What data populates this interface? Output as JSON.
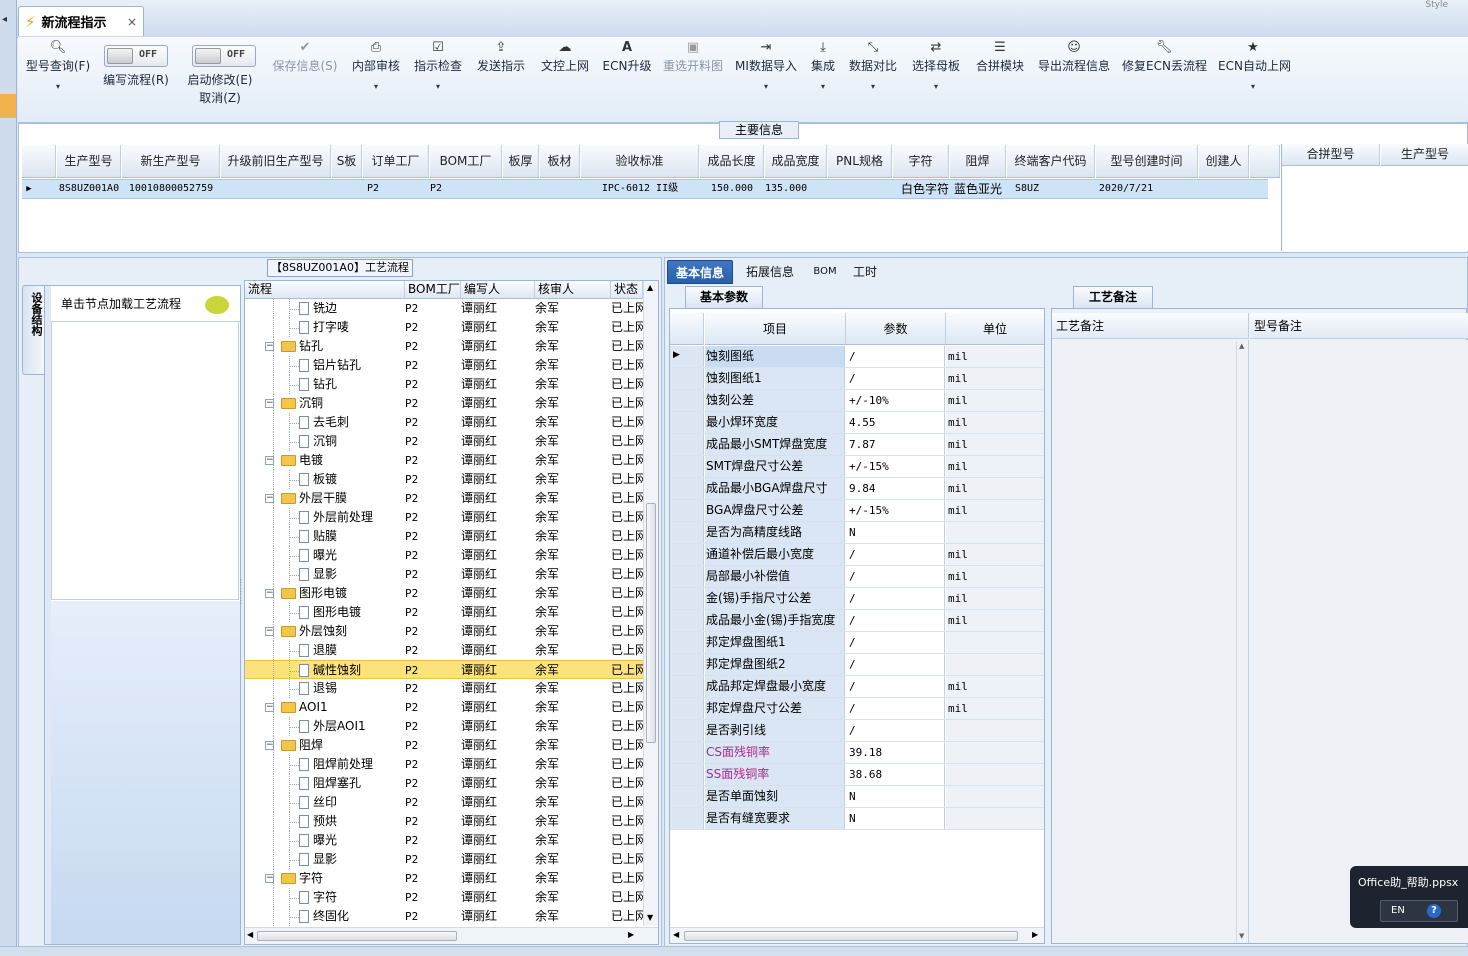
{
  "window": {
    "tab_title": "新流程指示",
    "close_glyph": "×",
    "top_right_hint": "Style"
  },
  "toolbar": {
    "query_model": "型号查询(F)",
    "edit_flow": "编写流程(R)",
    "edit_flow_toggle": "OFF",
    "enable_modify": "启动修改(E)",
    "enable_modify_toggle": "OFF",
    "cancel": "取消(Z)",
    "save_info": "保存信息(S)",
    "internal_review": "内部审核",
    "indicator_check": "指示检查",
    "send_indicator": "发送指示",
    "doc_upload": "文控上网",
    "ecn_upgrade": "ECN升级",
    "reselect_cut_chart": "重选开料图",
    "mi_import": "MI数据导入",
    "integrate": "集成",
    "data_compare": "数据对比",
    "select_mother_board": "选择母板",
    "merge_module": "合拼模块",
    "export_flow": "导出流程信息",
    "repair_ecn": "修复ECN丢流程",
    "ecn_auto_upload": "ECN自动上网"
  },
  "main_info": {
    "section_label": "主要信息",
    "columns": [
      "生产型号",
      "新生产型号",
      "升级前旧生产型号",
      "S板",
      "订单工厂",
      "BOM工厂",
      "板厚",
      "板材",
      "验收标准",
      "成品长度",
      "成品宽度",
      "PNL规格",
      "字符",
      "阻焊",
      "终端客户代码",
      "型号创建时间",
      "创建人"
    ],
    "row": {
      "production_model": "8S8UZ001A0",
      "new_production_model": "10010800052759",
      "order_factory": "P2",
      "bom_factory": "P2",
      "acceptance_standard": "IPC-6012 II级",
      "length": "150.000",
      "width": "135.000",
      "character": "白色字符",
      "solder_mask": "蓝色亚光",
      "customer_code": "S8UZ",
      "created_time": "2020/7/21"
    },
    "merge_columns": [
      "合拼型号",
      "生产型号"
    ]
  },
  "left_panel": {
    "flow_title": "【8S8UZ001A0】工艺流程",
    "vertical_tab": "设备结构",
    "device_header": "单击节点加载工艺流程",
    "tree_columns": [
      "流程",
      "BOM工厂",
      "编写人",
      "核审人",
      "状态"
    ],
    "tree_rows": [
      {
        "name": "铣边",
        "level": 1,
        "type": "doc",
        "bom": "P2",
        "writer": "谭丽红",
        "reviewer": "余军",
        "status": "已上网"
      },
      {
        "name": "打字唛",
        "level": 1,
        "type": "doc",
        "bom": "P2",
        "writer": "谭丽红",
        "reviewer": "余军",
        "status": "已上网"
      },
      {
        "name": "钻孔",
        "level": 0,
        "type": "folder",
        "bom": "P2",
        "writer": "谭丽红",
        "reviewer": "余军",
        "status": "已上网"
      },
      {
        "name": "铝片钻孔",
        "level": 1,
        "type": "doc",
        "bom": "P2",
        "writer": "谭丽红",
        "reviewer": "余军",
        "status": "已上网"
      },
      {
        "name": "钻孔",
        "level": 1,
        "type": "doc",
        "bom": "P2",
        "writer": "谭丽红",
        "reviewer": "余军",
        "status": "已上网"
      },
      {
        "name": "沉铜",
        "level": 0,
        "type": "folder",
        "bom": "P2",
        "writer": "谭丽红",
        "reviewer": "余军",
        "status": "已上网"
      },
      {
        "name": "去毛刺",
        "level": 1,
        "type": "doc",
        "bom": "P2",
        "writer": "谭丽红",
        "reviewer": "余军",
        "status": "已上网"
      },
      {
        "name": "沉铜",
        "level": 1,
        "type": "doc",
        "bom": "P2",
        "writer": "谭丽红",
        "reviewer": "余军",
        "status": "已上网"
      },
      {
        "name": "电镀",
        "level": 0,
        "type": "folder",
        "bom": "P2",
        "writer": "谭丽红",
        "reviewer": "余军",
        "status": "已上网"
      },
      {
        "name": "板镀",
        "level": 1,
        "type": "doc",
        "bom": "P2",
        "writer": "谭丽红",
        "reviewer": "余军",
        "status": "已上网"
      },
      {
        "name": "外层干膜",
        "level": 0,
        "type": "folder",
        "bom": "P2",
        "writer": "谭丽红",
        "reviewer": "余军",
        "status": "已上网"
      },
      {
        "name": "外层前处理",
        "level": 1,
        "type": "doc",
        "bom": "P2",
        "writer": "谭丽红",
        "reviewer": "余军",
        "status": "已上网"
      },
      {
        "name": "贴膜",
        "level": 1,
        "type": "doc",
        "bom": "P2",
        "writer": "谭丽红",
        "reviewer": "余军",
        "status": "已上网"
      },
      {
        "name": "曝光",
        "level": 1,
        "type": "doc",
        "bom": "P2",
        "writer": "谭丽红",
        "reviewer": "余军",
        "status": "已上网"
      },
      {
        "name": "显影",
        "level": 1,
        "type": "doc",
        "bom": "P2",
        "writer": "谭丽红",
        "reviewer": "余军",
        "status": "已上网"
      },
      {
        "name": "图形电镀",
        "level": 0,
        "type": "folder",
        "bom": "P2",
        "writer": "谭丽红",
        "reviewer": "余军",
        "status": "已上网"
      },
      {
        "name": "图形电镀",
        "level": 1,
        "type": "doc",
        "bom": "P2",
        "writer": "谭丽红",
        "reviewer": "余军",
        "status": "已上网"
      },
      {
        "name": "外层蚀刻",
        "level": 0,
        "type": "folder",
        "bom": "P2",
        "writer": "谭丽红",
        "reviewer": "余军",
        "status": "已上网"
      },
      {
        "name": "退膜",
        "level": 1,
        "type": "doc",
        "bom": "P2",
        "writer": "谭丽红",
        "reviewer": "余军",
        "status": "已上网"
      },
      {
        "name": "碱性蚀刻",
        "level": 1,
        "type": "doc",
        "bom": "P2",
        "writer": "谭丽红",
        "reviewer": "余军",
        "status": "已上网",
        "selected": true
      },
      {
        "name": "退锡",
        "level": 1,
        "type": "doc",
        "bom": "P2",
        "writer": "谭丽红",
        "reviewer": "余军",
        "status": "已上网"
      },
      {
        "name": "AOI1",
        "level": 0,
        "type": "folder",
        "bom": "P2",
        "writer": "谭丽红",
        "reviewer": "余军",
        "status": "已上网"
      },
      {
        "name": "外层AOI1",
        "level": 1,
        "type": "doc",
        "bom": "P2",
        "writer": "谭丽红",
        "reviewer": "余军",
        "status": "已上网"
      },
      {
        "name": "阻焊",
        "level": 0,
        "type": "folder",
        "bom": "P2",
        "writer": "谭丽红",
        "reviewer": "余军",
        "status": "已上网"
      },
      {
        "name": "阻焊前处理",
        "level": 1,
        "type": "doc",
        "bom": "P2",
        "writer": "谭丽红",
        "reviewer": "余军",
        "status": "已上网"
      },
      {
        "name": "阻焊塞孔",
        "level": 1,
        "type": "doc",
        "bom": "P2",
        "writer": "谭丽红",
        "reviewer": "余军",
        "status": "已上网"
      },
      {
        "name": "丝印",
        "level": 1,
        "type": "doc",
        "bom": "P2",
        "writer": "谭丽红",
        "reviewer": "余军",
        "status": "已上网"
      },
      {
        "name": "预烘",
        "level": 1,
        "type": "doc",
        "bom": "P2",
        "writer": "谭丽红",
        "reviewer": "余军",
        "status": "已上网"
      },
      {
        "name": "曝光",
        "level": 1,
        "type": "doc",
        "bom": "P2",
        "writer": "谭丽红",
        "reviewer": "余军",
        "status": "已上网"
      },
      {
        "name": "显影",
        "level": 1,
        "type": "doc",
        "bom": "P2",
        "writer": "谭丽红",
        "reviewer": "余军",
        "status": "已上网"
      },
      {
        "name": "字符",
        "level": 0,
        "type": "folder",
        "bom": "P2",
        "writer": "谭丽红",
        "reviewer": "余军",
        "status": "已上网"
      },
      {
        "name": "字符",
        "level": 1,
        "type": "doc",
        "bom": "P2",
        "writer": "谭丽红",
        "reviewer": "余军",
        "status": "已上网"
      },
      {
        "name": "终固化",
        "level": 1,
        "type": "doc",
        "bom": "P2",
        "writer": "谭丽红",
        "reviewer": "余军",
        "status": "已上网"
      }
    ]
  },
  "right_panel": {
    "tabs": [
      "基本信息",
      "拓展信息",
      "BOM",
      "工时"
    ],
    "active_tab": "基本信息",
    "param_title": "基本参数",
    "param_columns": [
      "项目",
      "参数",
      "单位"
    ],
    "params": [
      {
        "item": "蚀刻图纸",
        "value": "/",
        "unit": "mil",
        "selected": true
      },
      {
        "item": "蚀刻图纸1",
        "value": "/",
        "unit": "mil"
      },
      {
        "item": "蚀刻公差",
        "value": "+/-10%",
        "unit": "mil"
      },
      {
        "item": "最小焊环宽度",
        "value": "4.55",
        "unit": "mil"
      },
      {
        "item": "成品最小SMT焊盘宽度",
        "value": "7.87",
        "unit": "mil"
      },
      {
        "item": "SMT焊盘尺寸公差",
        "value": "+/-15%",
        "unit": "mil"
      },
      {
        "item": "成品最小BGA焊盘尺寸",
        "value": "9.84",
        "unit": "mil"
      },
      {
        "item": "BGA焊盘尺寸公差",
        "value": "+/-15%",
        "unit": "mil"
      },
      {
        "item": "是否为高精度线路",
        "value": "N",
        "unit": ""
      },
      {
        "item": "通道补偿后最小宽度",
        "value": "/",
        "unit": "mil"
      },
      {
        "item": "局部最小补偿值",
        "value": "/",
        "unit": "mil"
      },
      {
        "item": "金(锡)手指尺寸公差",
        "value": "/",
        "unit": "mil"
      },
      {
        "item": "成品最小金(锡)手指宽度",
        "value": "/",
        "unit": "mil"
      },
      {
        "item": "邦定焊盘图纸1",
        "value": "/",
        "unit": ""
      },
      {
        "item": "邦定焊盘图纸2",
        "value": "/",
        "unit": ""
      },
      {
        "item": "成品邦定焊盘最小宽度",
        "value": "/",
        "unit": "mil"
      },
      {
        "item": "邦定焊盘尺寸公差",
        "value": "/",
        "unit": "mil"
      },
      {
        "item": "是否剥引线",
        "value": "/",
        "unit": ""
      },
      {
        "item": "CS面残铜率",
        "value": "39.18",
        "unit": "",
        "pink": true
      },
      {
        "item": "SS面残铜率",
        "value": "38.68",
        "unit": "",
        "pink": true
      },
      {
        "item": "是否单面蚀刻",
        "value": "N",
        "unit": ""
      },
      {
        "item": "是否有缝宽要求",
        "value": "N",
        "unit": ""
      }
    ],
    "notes_title": "工艺备注",
    "notes_columns": [
      "工艺备注",
      "型号备注"
    ]
  },
  "office_popup": {
    "title": "Office助_帮助.ppsx",
    "lang": "EN",
    "help": "?"
  },
  "colors": {
    "accent_blue": "#2a5ea8",
    "selected_row": "#fbe27a",
    "pink_text": "#b0288a"
  }
}
